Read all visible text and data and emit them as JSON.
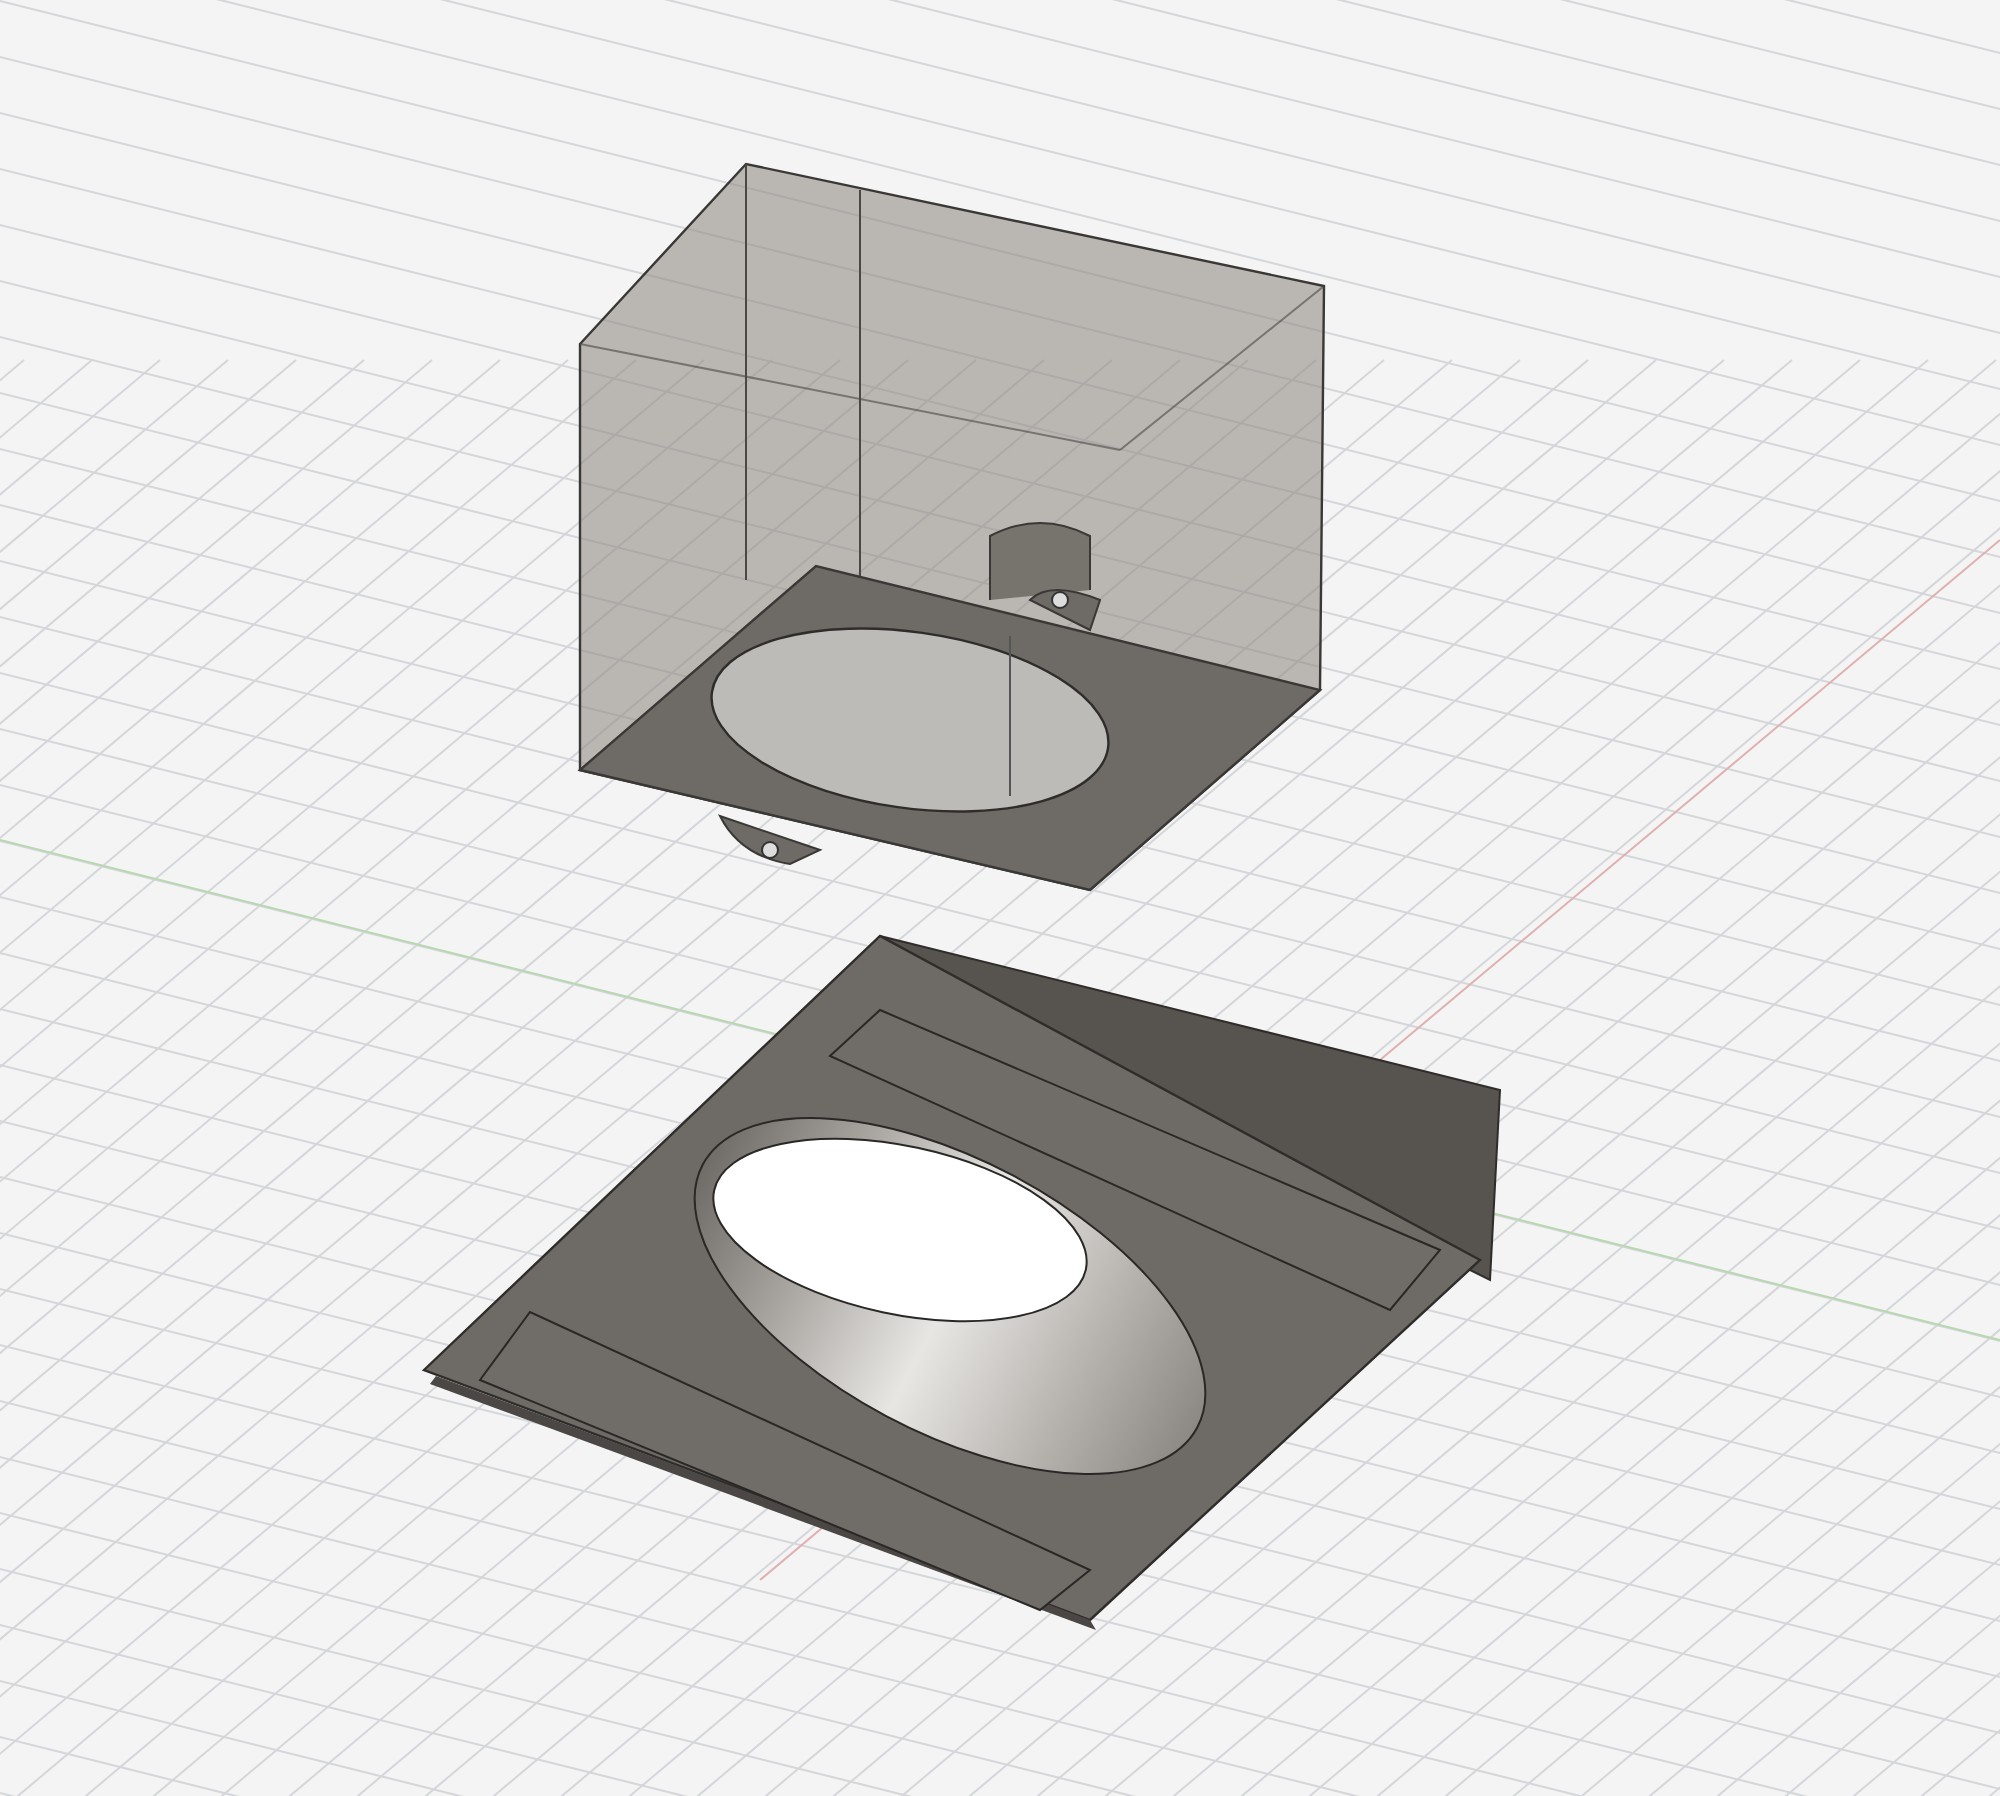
{
  "viewport": {
    "kind": "grid"
  }
}
